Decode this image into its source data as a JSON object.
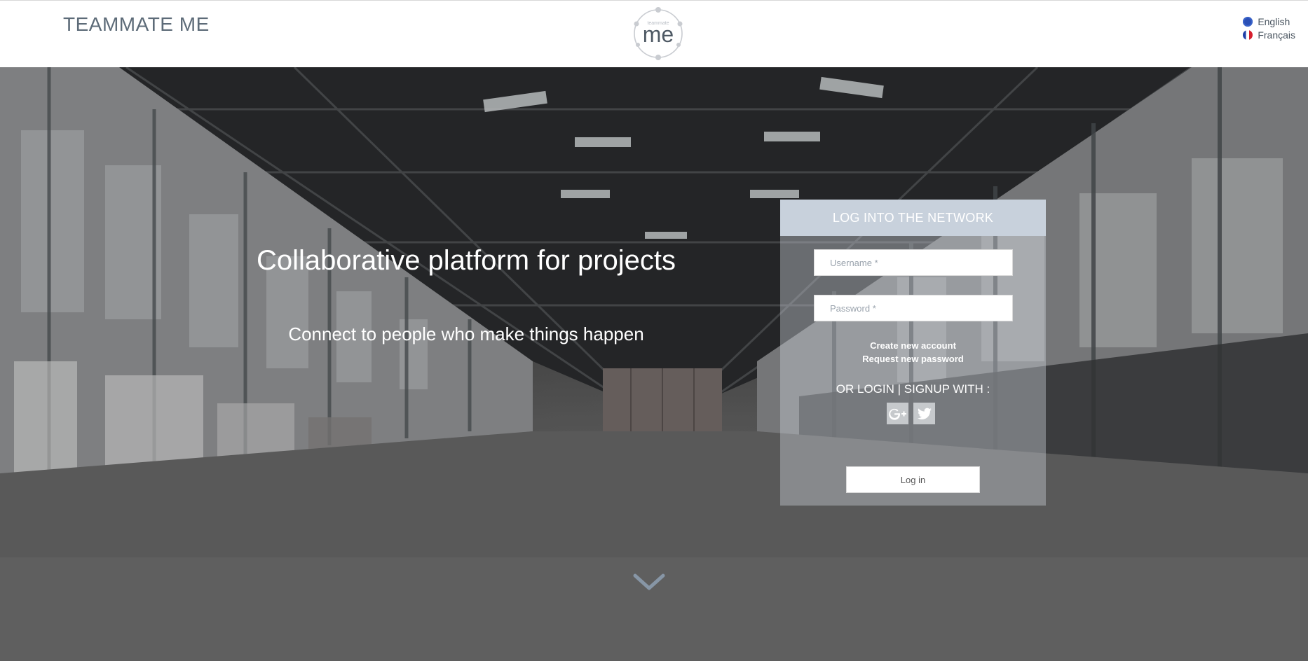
{
  "header": {
    "brand": "TEAMMATE ME",
    "logo_small_text": "teammate",
    "logo_text": "me",
    "languages": [
      {
        "label": "English",
        "flag": "eu-flag-icon"
      },
      {
        "label": "Français",
        "flag": "fr-flag-icon"
      }
    ]
  },
  "hero": {
    "title": "Collaborative platform for projects",
    "subtitle": "Connect to people who make things happen"
  },
  "login": {
    "heading": "LOG INTO THE NETWORK",
    "username_placeholder": "Username *",
    "password_placeholder": "Password *",
    "create_account": "Create new account",
    "request_password": "Request new password",
    "or_text": "OR LOGIN | SIGNUP WITH :",
    "social": [
      "google-plus-icon",
      "twitter-icon"
    ],
    "submit_label": "Log in"
  },
  "colors": {
    "panel_header": "#c8d1dc",
    "brand_text": "#5d6b78",
    "chevron": "#8796a6"
  }
}
